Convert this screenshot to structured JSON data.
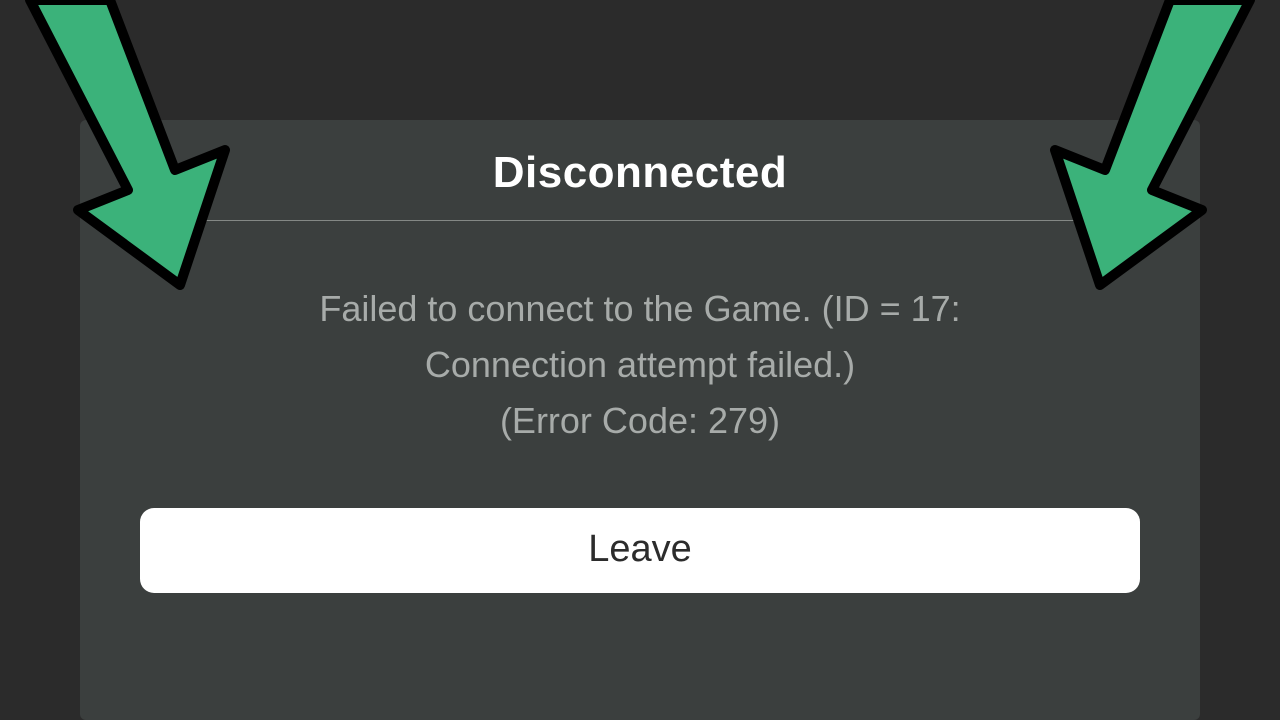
{
  "colors": {
    "page_bg": "#2b2b2b",
    "dialog_bg": "#3b3f3e",
    "title_text": "#ffffff",
    "body_text": "#a7aba9",
    "divider": "#848885",
    "button_bg": "#ffffff",
    "button_text": "#2c2c2c",
    "arrow_fill": "#3bb27a",
    "arrow_stroke": "#000000"
  },
  "dialog": {
    "title": "Disconnected",
    "message_line1": "Failed to connect to the Game. (ID = 17:",
    "message_line2": "Connection attempt failed.)",
    "message_line3": "(Error Code: 279)",
    "leave_label": "Leave"
  },
  "icons": {
    "left_arrow": "green-arrow-down-right",
    "right_arrow": "green-arrow-down-left"
  }
}
